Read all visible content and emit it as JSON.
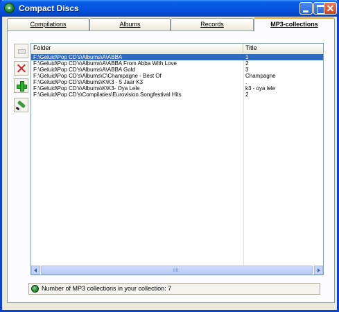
{
  "window": {
    "title": "Compact Discs"
  },
  "tabs": [
    {
      "label": "Compilations"
    },
    {
      "label": "Albums"
    },
    {
      "label": "Records"
    },
    {
      "label": "MP3-collections"
    }
  ],
  "list": {
    "columns": [
      "Folder",
      "Title"
    ],
    "rows": [
      {
        "folder": "F:\\Geluid\\Pop CD's\\Albums\\A\\ABBA",
        "title": "1",
        "selected": true
      },
      {
        "folder": "F:\\Geluid\\Pop CD's\\Albums\\A\\ABBA From Abba With Love",
        "title": "2"
      },
      {
        "folder": "F:\\Geluid\\Pop CD's\\Albums\\A\\ABBA Gold",
        "title": "3"
      },
      {
        "folder": "F:\\Geluid\\Pop CD's\\Albums\\C\\Champagne - Best Of",
        "title": "Champagne"
      },
      {
        "folder": "F:\\Geluid\\Pop CD's\\Albums\\K\\K3 - 5 Jaar K3",
        "title": "."
      },
      {
        "folder": "F:\\Geluid\\Pop CD's\\Albums\\K\\K3- Oya Lele",
        "title": "k3 - oya lele"
      },
      {
        "folder": "F:\\Geluid\\Pop CD's\\Compilaties\\Eurovision Songfestival Hits",
        "title": "2"
      }
    ]
  },
  "status": {
    "text": "Number of MP3 collections in your collection: 7"
  },
  "colors": {
    "selection": "#316ac5",
    "titlebar": "#0553df"
  }
}
